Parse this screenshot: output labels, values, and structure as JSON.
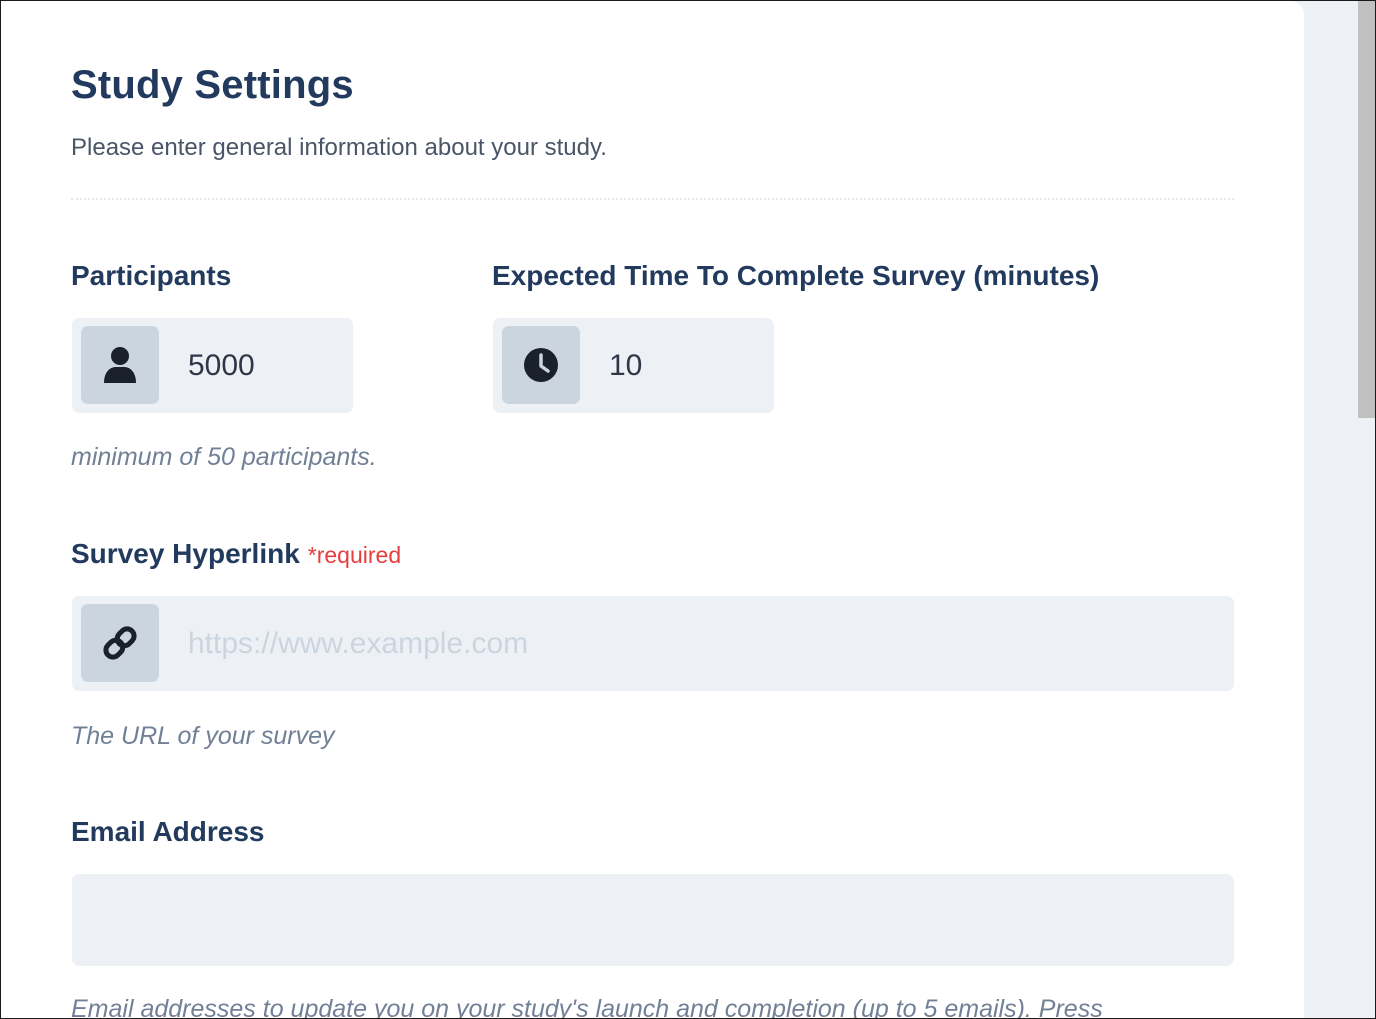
{
  "header": {
    "title": "Study Settings",
    "subtitle": "Please enter general information about your study."
  },
  "participants": {
    "label": "Participants",
    "value": "5000",
    "icon": "user-icon",
    "helper": "minimum of 50 participants."
  },
  "expected_time": {
    "label": "Expected Time To Complete Survey (minutes)",
    "value": "10",
    "icon": "clock-icon"
  },
  "survey_link": {
    "label": "Survey Hyperlink",
    "required_label": "*required",
    "placeholder": "https://www.example.com",
    "value": "",
    "icon": "link-icon",
    "helper": "The URL of your survey"
  },
  "email": {
    "label": "Email Address",
    "value": "",
    "helper": "Email addresses to update you on your study's launch and completion (up to 5 emails). Press"
  },
  "colors": {
    "heading": "#223a5e",
    "required": "#e53e3e",
    "input_bg": "#edf1f5",
    "icon_bg": "#cbd5df"
  }
}
